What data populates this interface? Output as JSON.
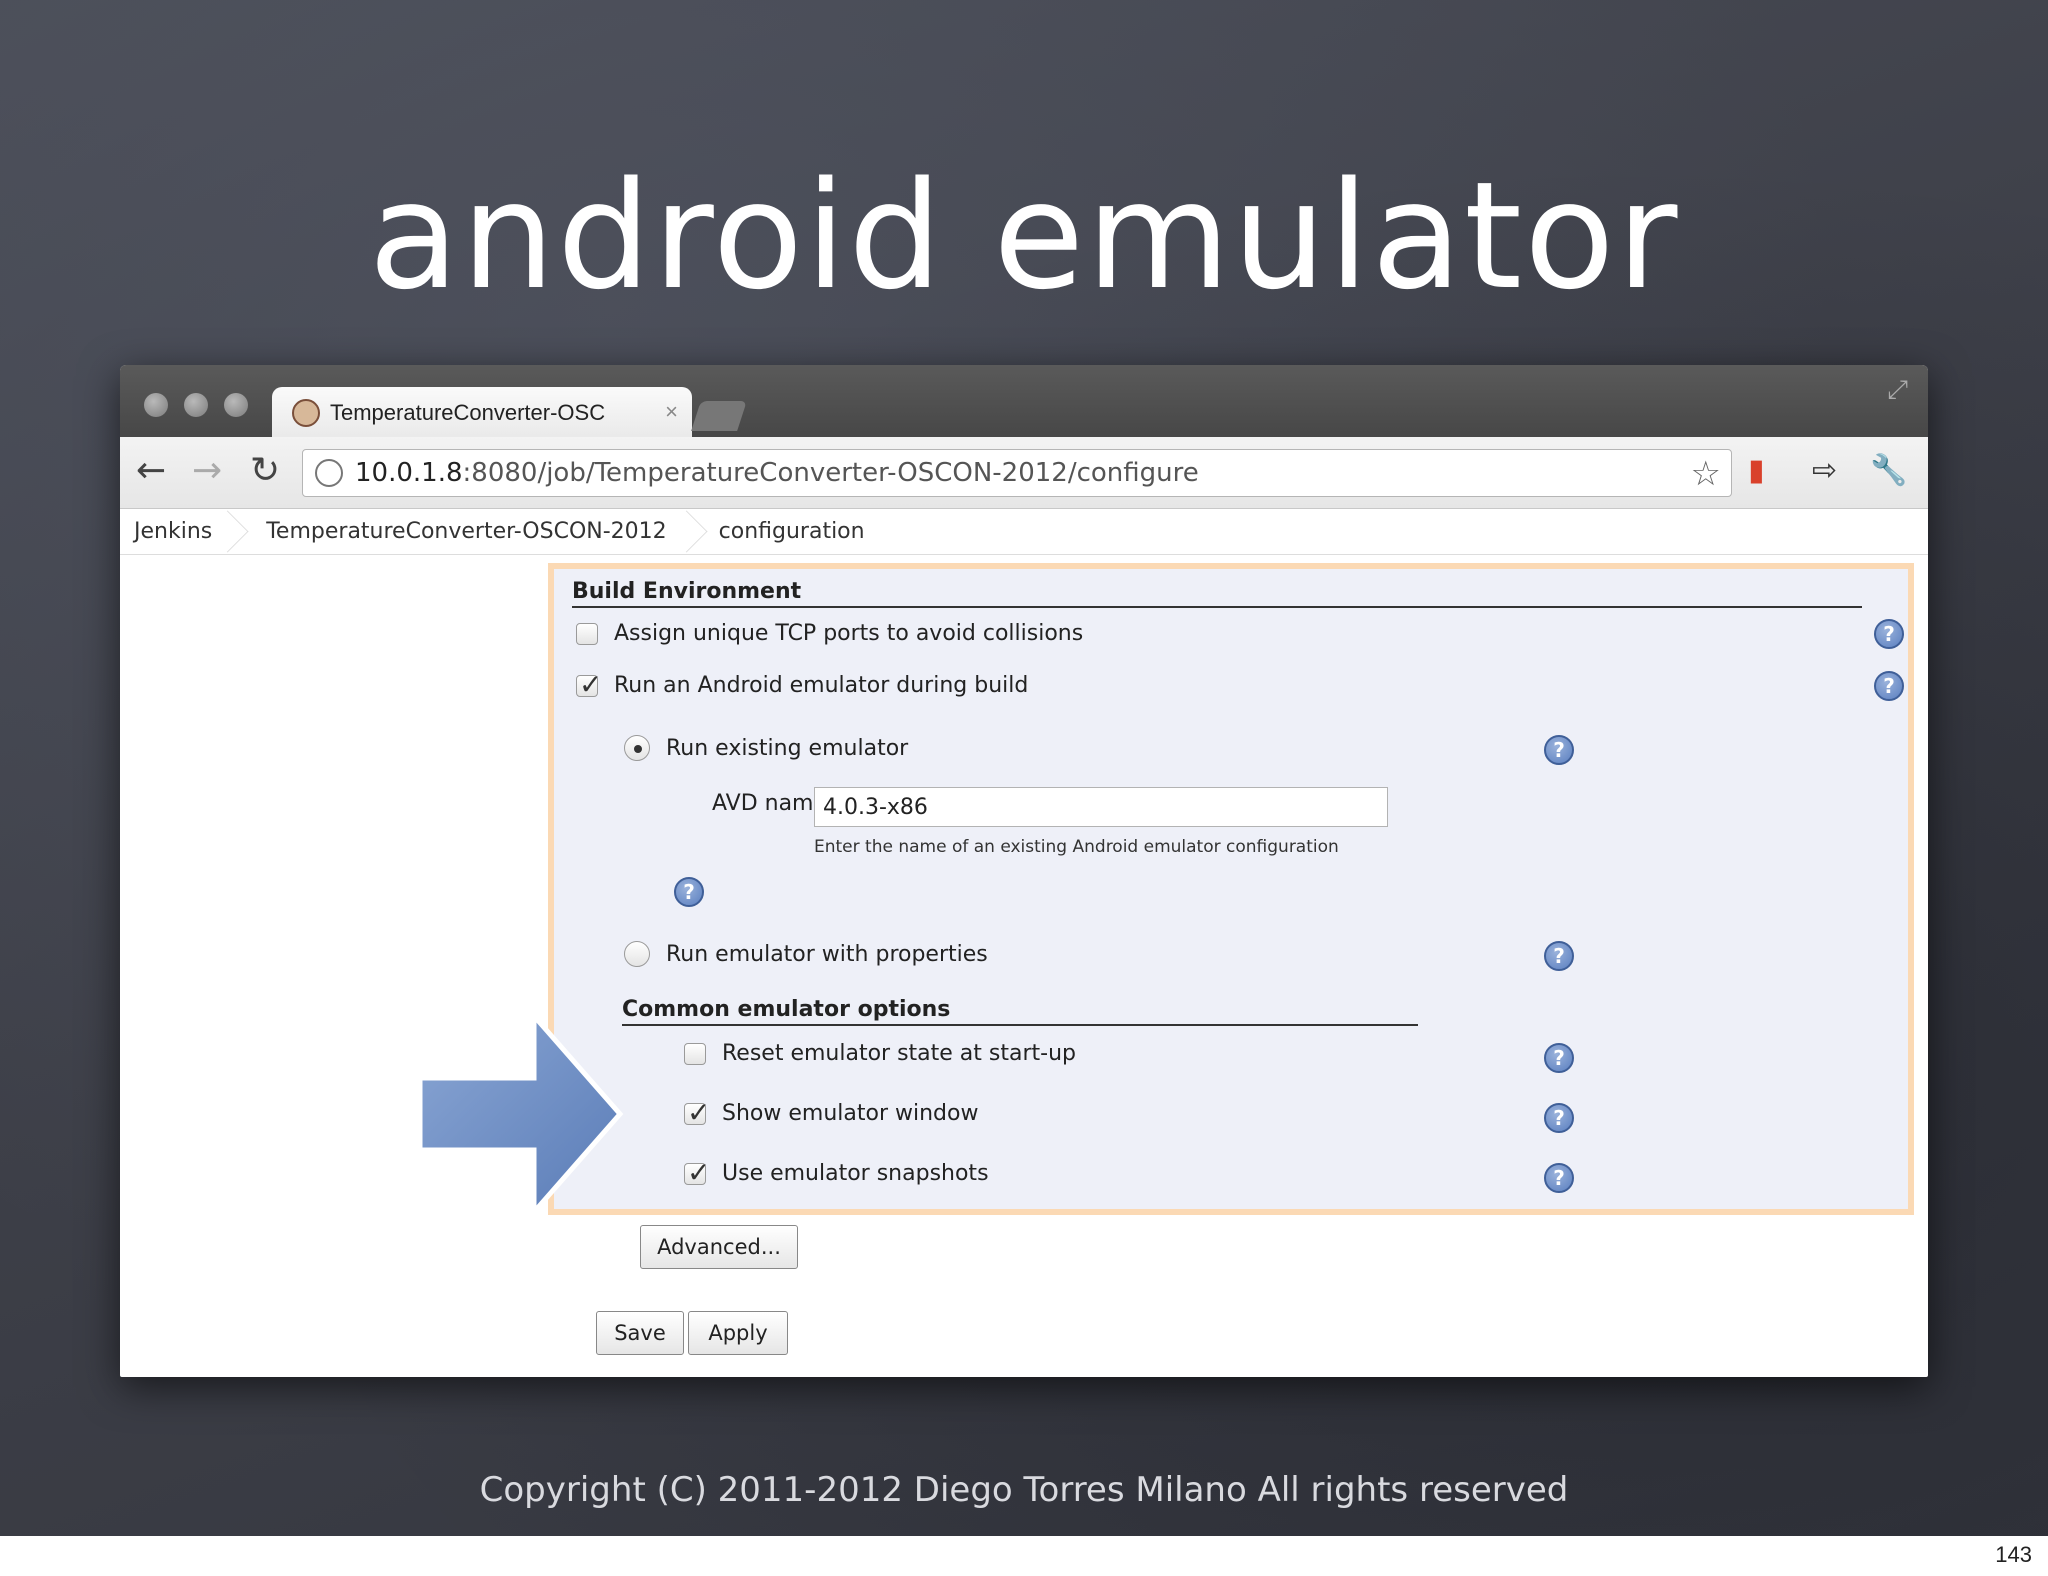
{
  "slide": {
    "title": "android emulator",
    "footer": "Copyright (C) 2011-2012   Diego Torres Milano   All rights reserved",
    "page_number": "143"
  },
  "browser": {
    "tab_title": "TemperatureConverter-OSC",
    "url_host": "10.0.1.8",
    "url_path": ":8080/job/TemperatureConverter-OSCON-2012/configure"
  },
  "breadcrumbs": [
    "Jenkins",
    "TemperatureConverter-OSCON-2012",
    "configuration"
  ],
  "build_environment": {
    "heading": "Build Environment",
    "assign_tcp_label": "Assign unique TCP ports to avoid collisions",
    "assign_tcp_checked": false,
    "run_emulator_label": "Run an Android emulator during build",
    "run_emulator_checked": true,
    "run_existing_label": "Run existing emulator",
    "avd_name_label": "AVD name",
    "avd_name_value": "4.0.3-x86",
    "avd_hint": "Enter the name of an existing Android emulator configuration",
    "run_properties_label": "Run emulator with properties"
  },
  "common_options": {
    "heading": "Common emulator options",
    "reset_label": "Reset emulator state at start-up",
    "reset_checked": false,
    "show_window_label": "Show emulator window",
    "show_window_checked": true,
    "snapshots_label": "Use emulator snapshots",
    "snapshots_checked": true
  },
  "buttons": {
    "advanced": "Advanced...",
    "save": "Save",
    "apply": "Apply"
  },
  "colors": {
    "highlight_border": "#fbd9b4",
    "config_bg": "#eef0f8",
    "arrow": "#6f8fc4"
  }
}
